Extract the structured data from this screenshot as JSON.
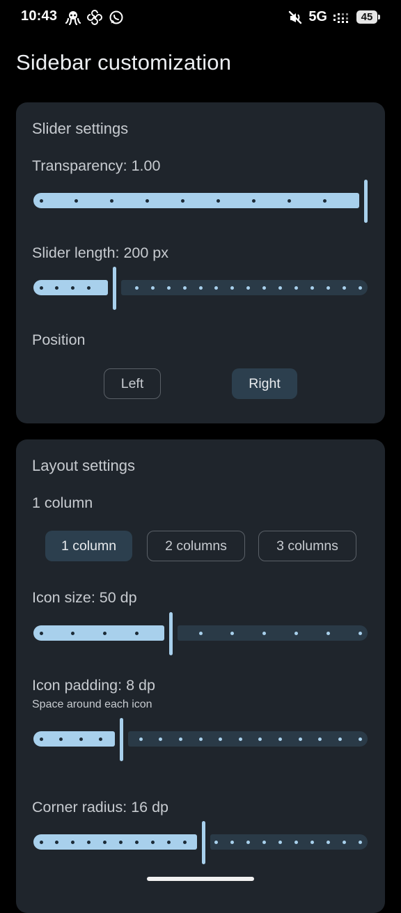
{
  "status_bar": {
    "time": "10:43",
    "network": "5G",
    "battery": "45",
    "left_icons": [
      "octopus-icon",
      "pinwheel-icon",
      "whatsapp-icon"
    ],
    "right_icons": [
      "mute-icon",
      "signal-icon"
    ]
  },
  "page": {
    "title": "Sidebar customization"
  },
  "slider_settings": {
    "title": "Slider settings",
    "transparency": {
      "label": "Transparency: 1.00",
      "value": 1.0,
      "min": 0,
      "max": 1,
      "steps": 10
    },
    "slider_length": {
      "label": "Slider length: 200 px",
      "fraction": 0.24,
      "dots": 21
    },
    "position": {
      "label": "Position",
      "options": [
        "Left",
        "Right"
      ],
      "selected": "Right"
    }
  },
  "layout_settings": {
    "title": "Layout settings",
    "columns": {
      "label": "1 column",
      "options": [
        "1 column",
        "2 columns",
        "3 columns"
      ],
      "selected": "1 column"
    },
    "icon_size": {
      "label": "Icon size: 50 dp",
      "fraction": 0.41,
      "dots": 11
    },
    "icon_padding": {
      "label": "Icon padding: 8 dp",
      "description": "Space around each icon",
      "fraction": 0.26,
      "dots": 17
    },
    "corner_radius": {
      "label": "Corner radius: 16 dp",
      "fraction": 0.51,
      "dots": 21
    }
  },
  "colors": {
    "background": "#000000",
    "card": "#1f252c",
    "slider_active": "#a8d0ec",
    "slider_inactive": "#2a3a47",
    "button_selected": "#2c3f4e",
    "text": "#c7cbd0"
  }
}
